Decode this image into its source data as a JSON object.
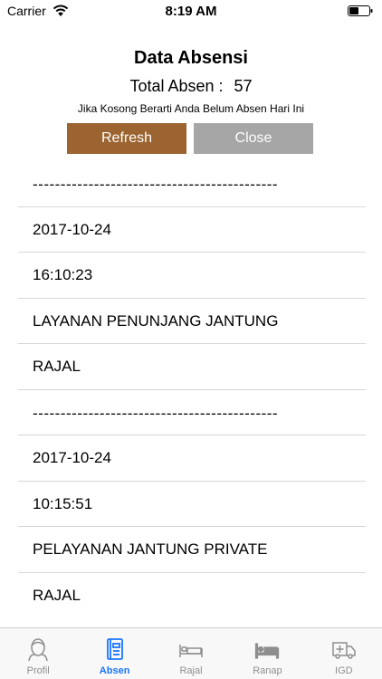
{
  "status_bar": {
    "carrier": "Carrier",
    "time": "8:19 AM"
  },
  "header": {
    "title": "Data Absensi",
    "total_label": "Total Absen :",
    "total_value": "57",
    "note": "Jika Kosong Berarti Anda Belum Absen Hari Ini"
  },
  "buttons": {
    "refresh": "Refresh",
    "close": "Close"
  },
  "records": [
    {
      "type": "sep",
      "text": "--------------------------------------------"
    },
    {
      "type": "item",
      "text": "2017-10-24"
    },
    {
      "type": "item",
      "text": "16:10:23"
    },
    {
      "type": "item",
      "text": "LAYANAN PENUNJANG JANTUNG"
    },
    {
      "type": "item",
      "text": "RAJAL"
    },
    {
      "type": "sep",
      "text": "--------------------------------------------"
    },
    {
      "type": "item",
      "text": "2017-10-24"
    },
    {
      "type": "item",
      "text": "10:15:51"
    },
    {
      "type": "item",
      "text": "PELAYANAN JANTUNG PRIVATE"
    },
    {
      "type": "item",
      "text": "RAJAL"
    }
  ],
  "tabs": [
    {
      "label": "Profil",
      "icon": "profile-icon",
      "active": false
    },
    {
      "label": "Absen",
      "icon": "notebook-icon",
      "active": true
    },
    {
      "label": "Rajal",
      "icon": "bed-icon",
      "active": false
    },
    {
      "label": "Ranap",
      "icon": "inpatient-bed-icon",
      "active": false
    },
    {
      "label": "IGD",
      "icon": "ambulance-icon",
      "active": false
    }
  ],
  "colors": {
    "refresh_bg": "#9b6430",
    "close_bg": "#a6a6a6",
    "tab_active": "#1a75ff",
    "tab_inactive": "#8e8e8e"
  }
}
